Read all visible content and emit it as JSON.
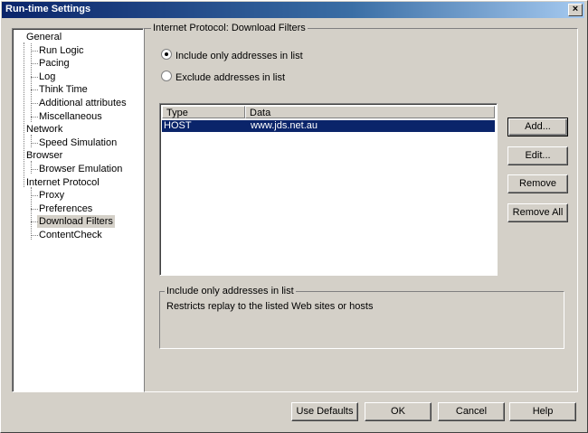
{
  "window": {
    "title": "Run-time Settings",
    "close_glyph": "×"
  },
  "tree": [
    {
      "label": "General",
      "level": 0
    },
    {
      "label": "Run Logic",
      "level": 1
    },
    {
      "label": "Pacing",
      "level": 1
    },
    {
      "label": "Log",
      "level": 1
    },
    {
      "label": "Think Time",
      "level": 1
    },
    {
      "label": "Additional attributes",
      "level": 1
    },
    {
      "label": "Miscellaneous",
      "level": 1
    },
    {
      "label": "Network",
      "level": 0
    },
    {
      "label": "Speed Simulation",
      "level": 1
    },
    {
      "label": "Browser",
      "level": 0
    },
    {
      "label": "Browser Emulation",
      "level": 1
    },
    {
      "label": "Internet Protocol",
      "level": 0
    },
    {
      "label": "Proxy",
      "level": 1
    },
    {
      "label": "Preferences",
      "level": 1
    },
    {
      "label": "Download Filters",
      "level": 1,
      "selected": true
    },
    {
      "label": "ContentCheck",
      "level": 1
    }
  ],
  "panel": {
    "title": "Internet Protocol: Download Filters",
    "radio_include": "Include only addresses in list",
    "radio_exclude": "Exclude addresses in list",
    "selected_radio": "include"
  },
  "list": {
    "columns": [
      "Type",
      "Data"
    ],
    "rows": [
      {
        "type": "HOST",
        "data": "www.jds.net.au"
      }
    ]
  },
  "side_buttons": {
    "add": "Add...",
    "edit": "Edit...",
    "remove": "Remove",
    "remove_all": "Remove All"
  },
  "description": {
    "title": "Include only addresses in list",
    "text": "Restricts replay to the listed Web sites or hosts"
  },
  "bottom_buttons": {
    "use_defaults": "Use Defaults",
    "ok": "OK",
    "cancel": "Cancel",
    "help": "Help"
  }
}
